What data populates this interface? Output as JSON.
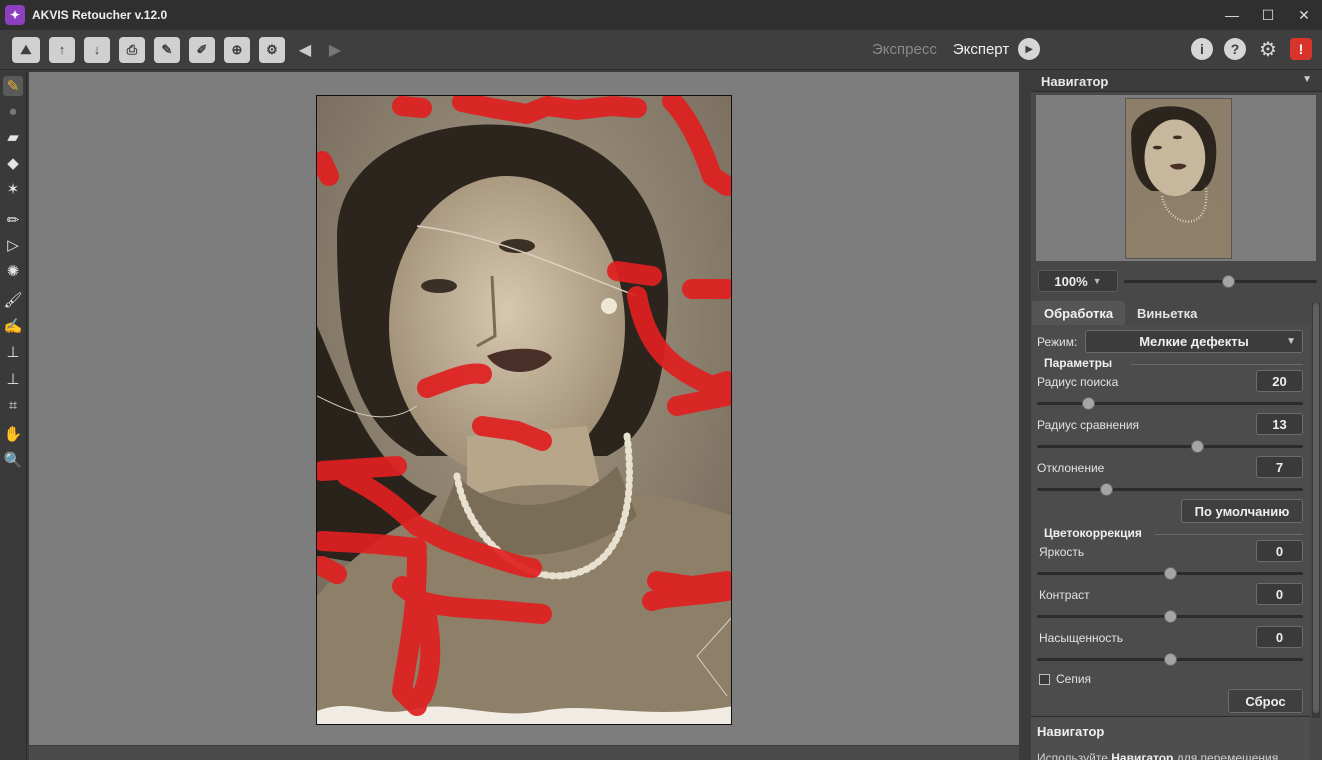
{
  "window": {
    "title": "AKVIS Retoucher v.12.0",
    "controls": [
      "—",
      "☐",
      "✕"
    ]
  },
  "toolbar": {
    "mode_express": "Экспресс",
    "mode_expert": "Эксперт",
    "active_mode": "Эксперт"
  },
  "navigator": {
    "title": "Навигатор",
    "zoom": "100%",
    "zoom_slider_fraction": 0.54
  },
  "tabs": {
    "processing": "Обработка",
    "vignette": "Виньетка",
    "active": "Обработка"
  },
  "settings": {
    "mode_label": "Режим:",
    "mode_value": "Мелкие дефекты",
    "params_title": "Параметры",
    "search_radius_label": "Радиус поиска",
    "search_radius_value": "20",
    "compare_radius_label": "Радиус сравнения",
    "compare_radius_value": "13",
    "deviation_label": "Отклонение",
    "deviation_value": "7",
    "default_button": "По умолчанию",
    "color_title": "Цветокоррекция",
    "brightness_label": "Яркость",
    "brightness_value": "0",
    "contrast_label": "Контраст",
    "contrast_value": "0",
    "saturation_label": "Насыщенность",
    "saturation_value": "0",
    "sepia_label": "Сепия",
    "sepia_checked": false,
    "reset_button": "Сброс"
  },
  "help": {
    "title": "Навигатор",
    "text_prefix": "Используйте ",
    "text_bold": "Навигатор",
    "text_suffix": " для перемещения"
  },
  "colors": {
    "accent_red": "#e02020",
    "canvas_bg": "#7d7d7d",
    "panel_bg": "#484848"
  }
}
